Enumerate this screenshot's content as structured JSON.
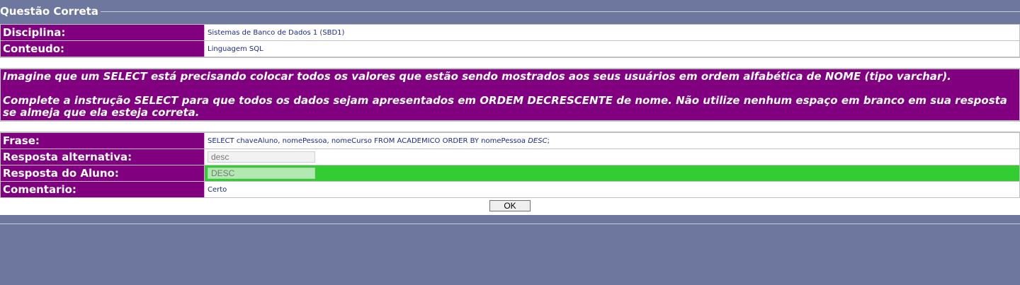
{
  "legend": "Questão Correta",
  "info": [
    {
      "label": "Disciplina:",
      "value": "Sistemas de Banco de Dados 1 (SBD1)"
    },
    {
      "label": "Conteudo:",
      "value": "Linguagem SQL"
    }
  ],
  "question": {
    "paragraph1": "Imagine que um SELECT está precisando colocar todos os valores que estão sendo mostrados aos seus usuários em ordem alfabética de NOME (tipo varchar).",
    "paragraph2": "Complete a instrução SELECT para que todos os dados sejam apresentados em ORDEM DECRESCENTE de nome. Não utilize nenhum espaço em branco em sua resposta se almeja que ela esteja correta."
  },
  "answer": {
    "phrase_label": "Frase:",
    "phrase_prefix": "SELECT chaveAluno, nomePessoa, nomeCurso FROM ACADEMICO ORDER BY nomePessoa ",
    "phrase_answer": "DESC",
    "phrase_suffix": ";",
    "alt_label": "Resposta alternativa:",
    "alt_value": "desc",
    "student_label": "Resposta do Aluno:",
    "student_value": "DESC",
    "comment_label": "Comentario:",
    "comment_value": "Certo"
  },
  "ok_label": "OK",
  "colors": {
    "page_bg": "#6e789e",
    "label_bg": "#800080",
    "correct_bg": "#33cc33",
    "value_text": "#1b2b8a"
  }
}
